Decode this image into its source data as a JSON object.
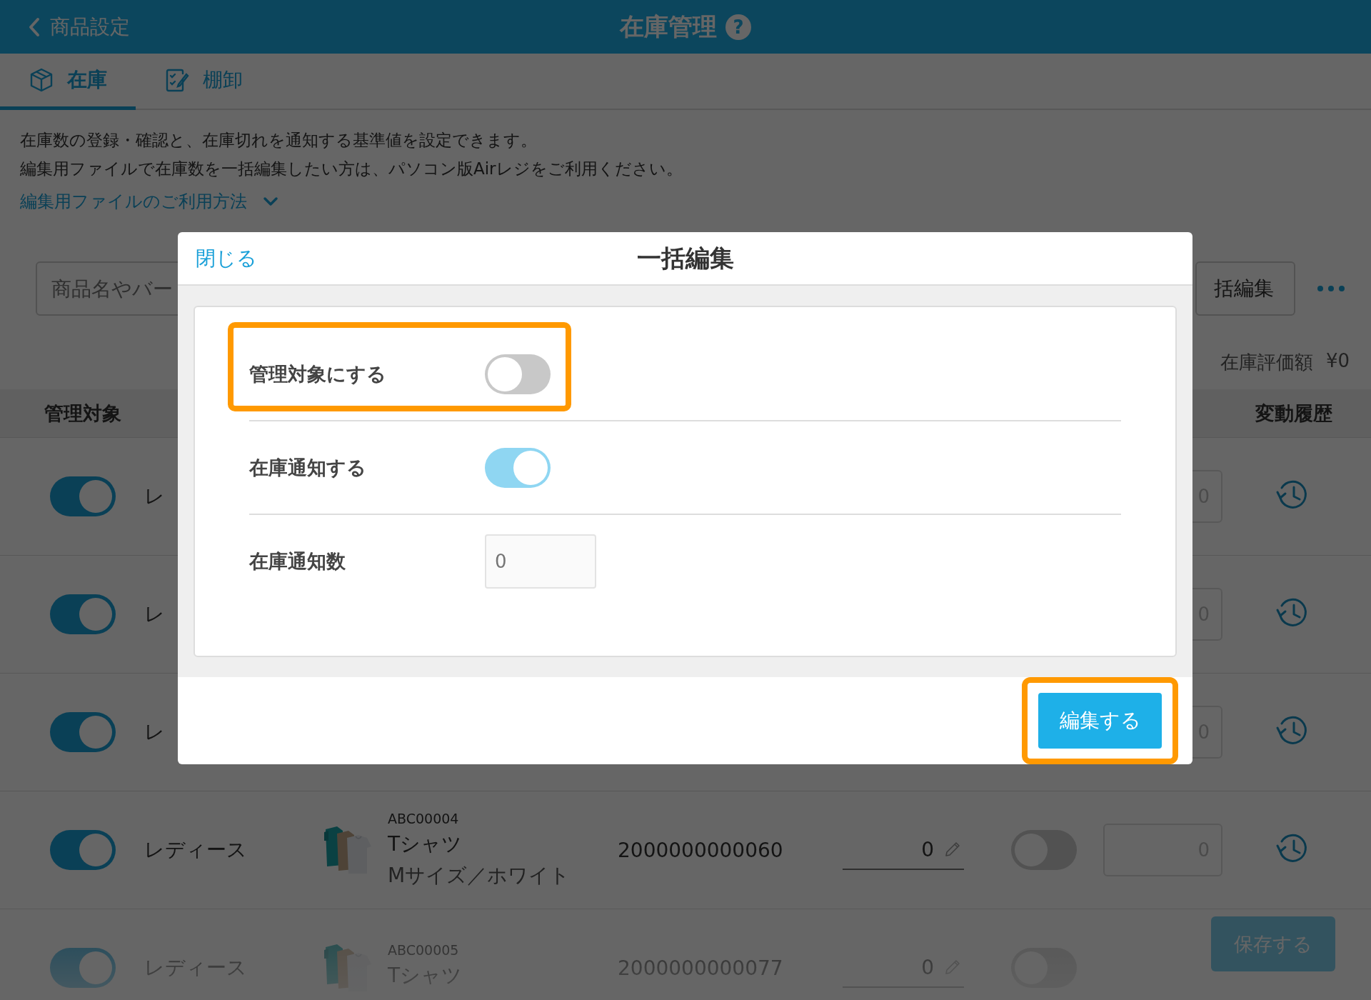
{
  "header": {
    "back_label": "商品設定",
    "title": "在庫管理",
    "help": "?"
  },
  "tabs": [
    {
      "label": "在庫",
      "selected": true,
      "kind": "box"
    },
    {
      "label": "棚卸",
      "selected": false,
      "kind": "checklist"
    }
  ],
  "description": [
    "在庫数の登録・確認と、在庫切れを通知する基準値を設定できます。",
    "編集用ファイルで在庫数を一括編集したい方は、パソコン版Airレジをご利用ください。"
  ],
  "help_link": {
    "label": "編集用ファイルのご利用方法",
    "expanded": false
  },
  "search": {
    "placeholder": "商品名やバー"
  },
  "bulk_edit_button": "括編集",
  "valuation": {
    "label": "在庫評価額",
    "value": "¥0"
  },
  "table": {
    "columns": [
      {
        "label": "管理対象"
      },
      {
        "label": "変動履歴"
      }
    ],
    "rows": [
      {
        "managed": true,
        "category": "レ",
        "alert_count": "0"
      },
      {
        "managed": true,
        "category": "レ",
        "alert_count": "0"
      },
      {
        "managed": true,
        "category": "レ",
        "alert_count": "0"
      },
      {
        "managed": true,
        "category": "レディース",
        "code": "ABC00004",
        "name": "Tシャツ",
        "variant": "Mサイズ／ホワイト",
        "barcode": "2000000000060",
        "stock": "0",
        "alert": false,
        "alert_count": "0"
      },
      {
        "managed": true,
        "category": "レディース",
        "code": "ABC00005",
        "name": "Tシャツ",
        "barcode": "2000000000077",
        "stock": "0",
        "alert": false
      }
    ]
  },
  "save_button": "保存する",
  "modal": {
    "close": "閉じる",
    "title": "一括編集",
    "settings": [
      {
        "kind": "toggle",
        "label": "管理対象にする",
        "on": false,
        "highlighted": true
      },
      {
        "kind": "toggle",
        "label": "在庫通知する",
        "on": true,
        "highlighted": false
      },
      {
        "kind": "number",
        "label": "在庫通知数",
        "placeholder": "0",
        "highlighted": false
      }
    ],
    "submit": {
      "label": "編集する",
      "highlighted": true
    }
  }
}
